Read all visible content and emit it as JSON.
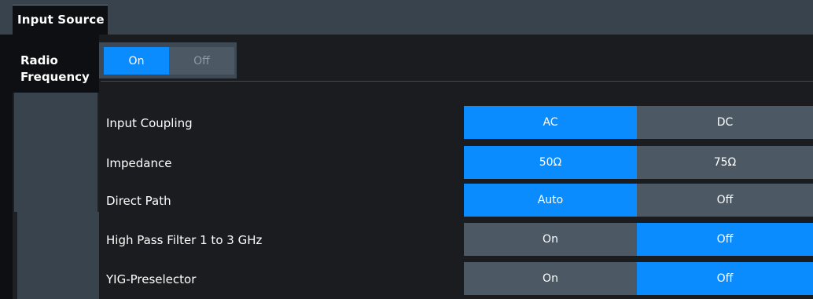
{
  "title": "Input Source",
  "side_tabs": [
    {
      "label_line1": "Radio",
      "label_line2": "Frequency"
    }
  ],
  "radio_frequency": {
    "on_label": "On",
    "off_label": "Off",
    "selected": "On"
  },
  "settings": [
    {
      "label": "Input Coupling",
      "left": "AC",
      "right": "DC",
      "selected": "AC"
    },
    {
      "label": "Impedance",
      "left": "50Ω",
      "right": "75Ω",
      "selected": "50Ω"
    },
    {
      "label": "Direct Path",
      "left": "Auto",
      "right": "Off",
      "selected": "Auto"
    },
    {
      "label": "High Pass Filter 1 to 3 GHz",
      "left": "On",
      "right": "Off",
      "selected": "Off"
    },
    {
      "label": "YIG-Preselector",
      "left": "On",
      "right": "Off",
      "selected": "Off"
    }
  ],
  "colors": {
    "accent": "#0a8cff",
    "inactive": "#4c5964",
    "panel": "#38434d"
  }
}
